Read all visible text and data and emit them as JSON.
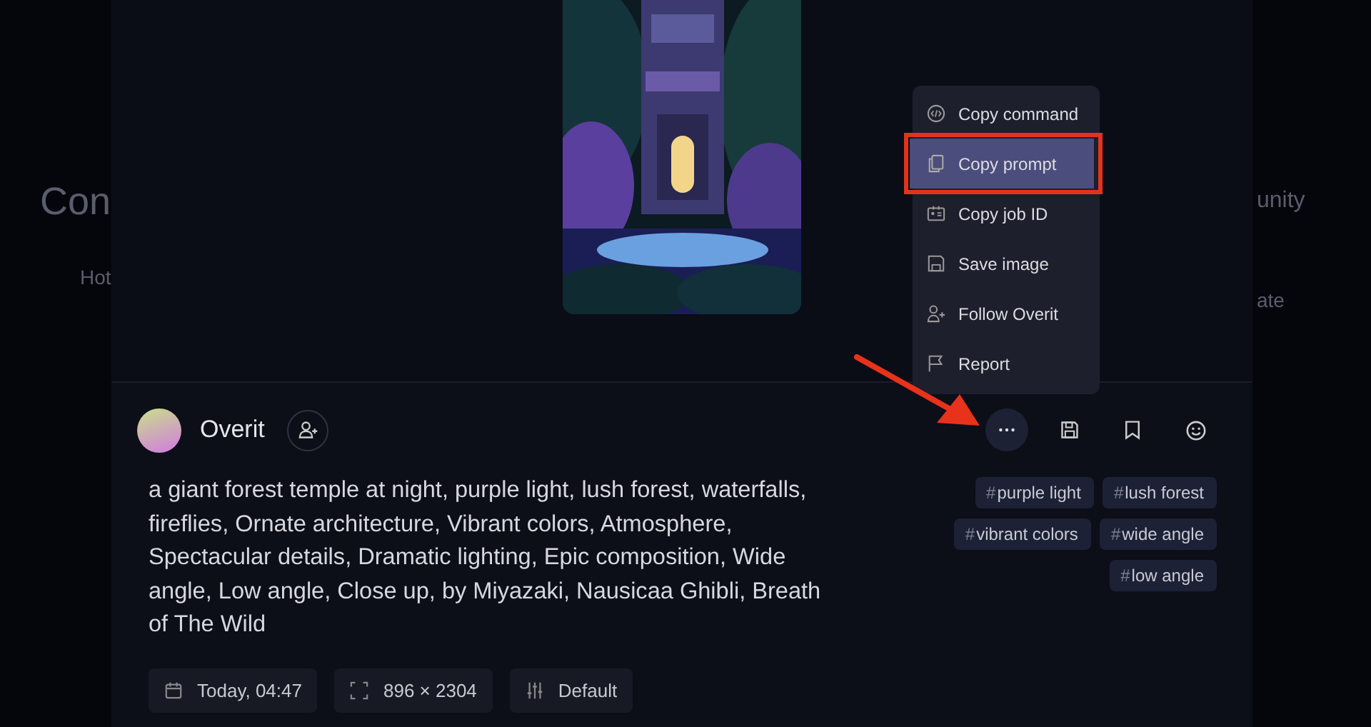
{
  "backdrop": {
    "left_texts": [
      "Con",
      "Hot"
    ],
    "right_texts": [
      "unity",
      "ate"
    ]
  },
  "author": {
    "name": "Overit"
  },
  "actions": [
    {
      "kind": "more",
      "selected": true
    },
    {
      "kind": "save",
      "selected": false
    },
    {
      "kind": "bookmark",
      "selected": false
    },
    {
      "kind": "emoji",
      "selected": false
    }
  ],
  "menu": {
    "items": [
      {
        "kind": "code",
        "label": "Copy command",
        "selected": false
      },
      {
        "kind": "copy",
        "label": "Copy prompt",
        "selected": true
      },
      {
        "kind": "id",
        "label": "Copy job ID",
        "selected": false
      },
      {
        "kind": "save",
        "label": "Save image",
        "selected": false
      },
      {
        "kind": "follow",
        "label": "Follow Overit",
        "selected": false
      },
      {
        "kind": "flag",
        "label": "Report",
        "selected": false
      }
    ]
  },
  "prompt": "a giant forest temple at night, purple light, lush forest, waterfalls, fireflies, Ornate architecture, Vibrant colors, Atmosphere, Spectacular details, Dramatic lighting, Epic composition, Wide angle, Low angle, Close up, by Miyazaki, Nausicaa Ghibli, Breath of The Wild",
  "tags": [
    {
      "mark": "#",
      "label": "purple light"
    },
    {
      "mark": "#",
      "label": "lush forest"
    },
    {
      "mark": "#",
      "label": "vibrant colors"
    },
    {
      "mark": "#",
      "label": "wide angle"
    },
    {
      "mark": "#",
      "label": "low angle"
    }
  ],
  "details": [
    {
      "kind": "date",
      "label": "Today, 04:47"
    },
    {
      "kind": "size",
      "label": "896 × 2304"
    },
    {
      "kind": "style",
      "label": "Default"
    }
  ],
  "annotation": {
    "highlight_selected": true,
    "arrow": true
  }
}
